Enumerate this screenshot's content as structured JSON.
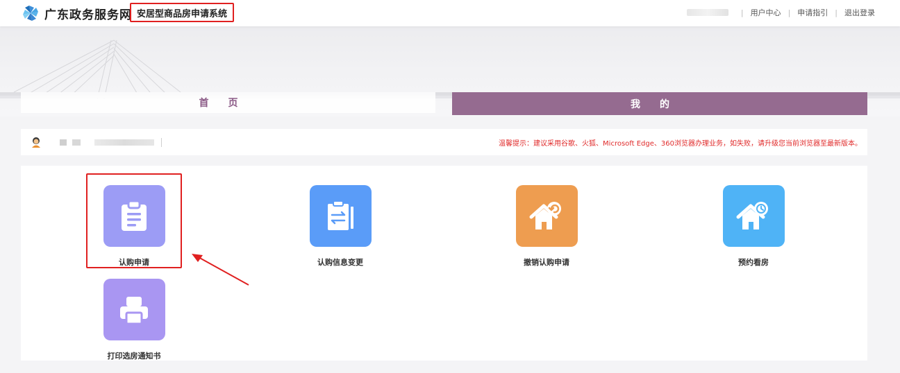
{
  "header": {
    "site_name": "广东政务服务网",
    "system_title": "安居型商品房申请系统",
    "links": [
      "用户中心",
      "申请指引",
      "退出登录"
    ]
  },
  "tabs": {
    "home": "首页",
    "mine": "我的"
  },
  "tip": "温馨提示：建议采用谷歌、火狐、Microsoft Edge、360浏览器办理业务，如失败，请升级您当前浏览器至最新版本。",
  "cards": [
    {
      "label": "认购申请",
      "color": "#9c9cf5",
      "icon": "clipboard-icon"
    },
    {
      "label": "认购信息变更",
      "color": "#5a9cf8",
      "icon": "swap-document-icon"
    },
    {
      "label": "撤销认购申请",
      "color": "#ee9d50",
      "icon": "house-undo-icon"
    },
    {
      "label": "预约看房",
      "color": "#4fb3f6",
      "icon": "house-clock-icon"
    },
    {
      "label": "打印选房通知书",
      "color": "#a996f2",
      "icon": "printer-icon"
    }
  ],
  "colors": {
    "accent": "#956b90",
    "highlight": "#e02020",
    "tip": "#e02a2a"
  }
}
